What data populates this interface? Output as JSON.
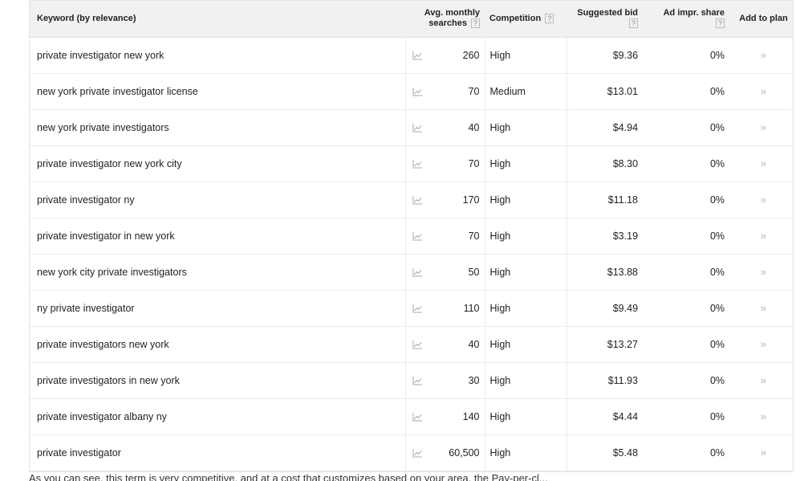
{
  "columns": {
    "keyword": "Keyword (by relevance)",
    "avg_monthly_searches_line1": "Avg. monthly",
    "avg_monthly_searches_line2": "searches",
    "competition": "Competition",
    "suggested_bid": "Suggested bid",
    "ad_impr_share": "Ad impr. share",
    "add_to_plan": "Add to plan",
    "help_glyph": "?"
  },
  "icons": {
    "trend": "trend-chart-icon",
    "add": "double-chevron-right-icon",
    "add_glyph": "»"
  },
  "rows": [
    {
      "keyword": "private investigator new york",
      "searches": "260",
      "competition": "High",
      "bid": "$9.36",
      "share": "0%"
    },
    {
      "keyword": "new york private investigator license",
      "searches": "70",
      "competition": "Medium",
      "bid": "$13.01",
      "share": "0%"
    },
    {
      "keyword": "new york private investigators",
      "searches": "40",
      "competition": "High",
      "bid": "$4.94",
      "share": "0%"
    },
    {
      "keyword": "private investigator new york city",
      "searches": "70",
      "competition": "High",
      "bid": "$8.30",
      "share": "0%"
    },
    {
      "keyword": "private investigator ny",
      "searches": "170",
      "competition": "High",
      "bid": "$11.18",
      "share": "0%"
    },
    {
      "keyword": "private investigator in new york",
      "searches": "70",
      "competition": "High",
      "bid": "$3.19",
      "share": "0%"
    },
    {
      "keyword": "new york city private investigators",
      "searches": "50",
      "competition": "High",
      "bid": "$13.88",
      "share": "0%"
    },
    {
      "keyword": "ny private investigator",
      "searches": "110",
      "competition": "High",
      "bid": "$9.49",
      "share": "0%"
    },
    {
      "keyword": "private investigators new york",
      "searches": "40",
      "competition": "High",
      "bid": "$13.27",
      "share": "0%"
    },
    {
      "keyword": "private investigators in new york",
      "searches": "30",
      "competition": "High",
      "bid": "$11.93",
      "share": "0%"
    },
    {
      "keyword": "private investigator albany ny",
      "searches": "140",
      "competition": "High",
      "bid": "$4.44",
      "share": "0%"
    },
    {
      "keyword": "private investigator",
      "searches": "60,500",
      "competition": "High",
      "bid": "$5.48",
      "share": "0%"
    }
  ],
  "footer_text": "As you can see, this term is very competitive, and at a cost that customizes based on your area, the Pay-per-cl..."
}
